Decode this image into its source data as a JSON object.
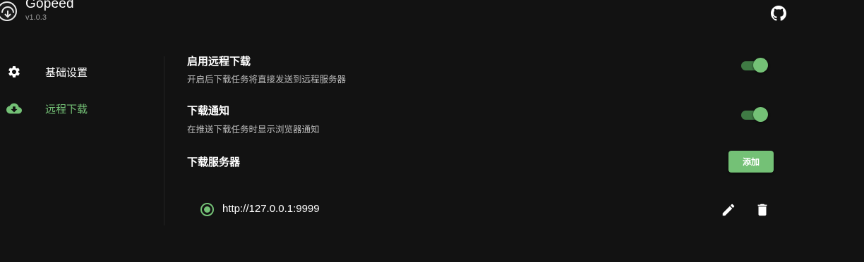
{
  "app": {
    "title": "Gopeed",
    "version": "v1.0.3",
    "logo_icon": "gopeed-logo-icon",
    "github_icon": "github-icon"
  },
  "sidebar": {
    "items": [
      {
        "label": "基础设置",
        "icon": "gear-icon",
        "active": false
      },
      {
        "label": "远程下载",
        "icon": "cloud-download-icon",
        "active": true
      }
    ]
  },
  "settings": {
    "remote_download": {
      "title": "启用远程下载",
      "description": "开启后下载任务将直接发送到远程服务器",
      "enabled": true
    },
    "download_notification": {
      "title": "下载通知",
      "description": "在推送下载任务时显示浏览器通知",
      "enabled": true
    },
    "servers": {
      "title": "下载服务器",
      "add_label": "添加",
      "list": [
        {
          "url": "http://127.0.0.1:9999",
          "selected": true
        }
      ]
    }
  },
  "colors": {
    "accent": "#74c176",
    "accent_dark": "#3f7a44",
    "background": "#121212"
  }
}
